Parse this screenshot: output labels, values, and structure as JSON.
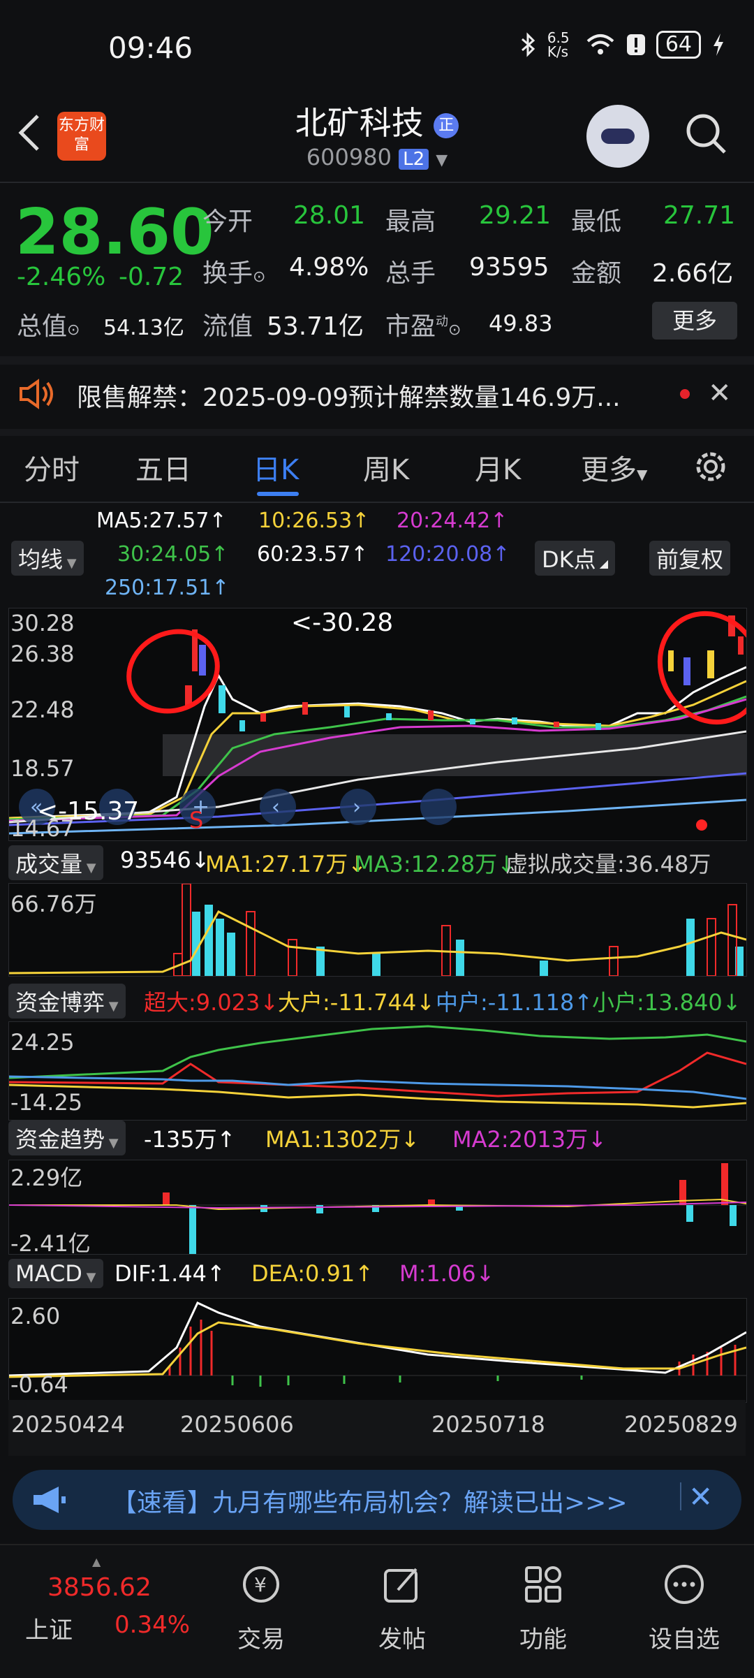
{
  "status_bar": {
    "time": "09:46",
    "speed": "6.5 K/s",
    "battery": "64"
  },
  "header": {
    "back_icon": "back-chevron-icon",
    "logo_text": "东方财富",
    "title": "北矿科技",
    "title_badge": "正",
    "code": "600980",
    "level": "L2"
  },
  "quote": {
    "price": "28.60",
    "pct": "-2.46%",
    "chg": "-0.72",
    "rows": [
      [
        {
          "label": "今开",
          "value": "28.01",
          "color": "green"
        },
        {
          "label": "最高",
          "value": "29.21",
          "color": "green"
        },
        {
          "label": "最低",
          "value": "27.71",
          "color": "green"
        }
      ],
      [
        {
          "label": "换手",
          "value": "4.98%",
          "color": "white"
        },
        {
          "label": "总手",
          "value": "93595",
          "color": "white"
        },
        {
          "label": "金额",
          "value": "2.66亿",
          "color": "white"
        }
      ]
    ],
    "total_value_label": "总值",
    "total_value": "54.13亿",
    "float_value_label": "流值",
    "float_value": "53.71亿",
    "pe_label": "市盈",
    "pe_sup": "动",
    "pe_value": "49.83",
    "more_label": "更多"
  },
  "notice": {
    "label": "限售解禁：2025-09-09预计解禁数量146.9万..."
  },
  "tabs": [
    "分时",
    "五日",
    "日K",
    "周K",
    "月K",
    "更多"
  ],
  "active_tab": "日K",
  "ma_legend": {
    "type_label": "均线",
    "items": [
      {
        "text": "MA5:27.57↑",
        "color": "#ffffff"
      },
      {
        "text": "10:26.53↑",
        "color": "#f5d23a"
      },
      {
        "text": "20:24.42↑",
        "color": "#d63bd0"
      },
      {
        "text": "30:24.05↑",
        "color": "#3fc34a"
      },
      {
        "text": "60:23.57↑",
        "color": "#ffffff"
      },
      {
        "text": "120:20.08↑",
        "color": "#5b62f0"
      },
      {
        "text": "250:17.51↑",
        "color": "#6fb4f5"
      }
    ],
    "dk_label": "DK点",
    "fq_label": "前复权"
  },
  "kline": {
    "y_ticks": [
      "30.28",
      "26.38",
      "22.48",
      "18.57",
      "14.67"
    ],
    "high_label": "<-30.28",
    "low_label": "<-15.37",
    "s_mark": "S"
  },
  "volume": {
    "label": "成交量",
    "value": "93546↓",
    "ma1": "MA1:27.17万↓",
    "ma3": "MA3:12.28万↓",
    "virtual": "虚拟成交量:36.48万",
    "y_top": "66.76万"
  },
  "capital_game": {
    "label": "资金博弈",
    "super": "超大:9.023↓",
    "large": "大户:-11.744↓",
    "medium": "中户:-11.118↑",
    "small": "小户:13.840↓",
    "y_top": "24.25",
    "y_bottom": "-14.25"
  },
  "capital_trend": {
    "label": "资金趋势",
    "value": "-135万↑",
    "ma1": "MA1:1302万↓",
    "ma2": "MA2:2013万↓",
    "y_top": "2.29亿",
    "y_bottom": "-2.41亿"
  },
  "macd": {
    "label": "MACD",
    "dif": "DIF:1.44↑",
    "dea": "DEA:0.91↑",
    "m": "M:1.06↓",
    "y_top": "2.60",
    "y_bottom": "-0.64"
  },
  "dates": [
    "20250424",
    "20250606",
    "20250718",
    "20250829"
  ],
  "banner": {
    "text": "【速看】九月有哪些布局机会？解读已出>>>"
  },
  "bottom_nav": {
    "index_value": "3856.62",
    "index_name": "上证",
    "index_pct": "0.34%",
    "items": [
      "交易",
      "发帖",
      "功能",
      "设自选"
    ]
  },
  "colors": {
    "up": "#f02a2a",
    "down": "#28c53c",
    "accent": "#3d7ff2"
  }
}
